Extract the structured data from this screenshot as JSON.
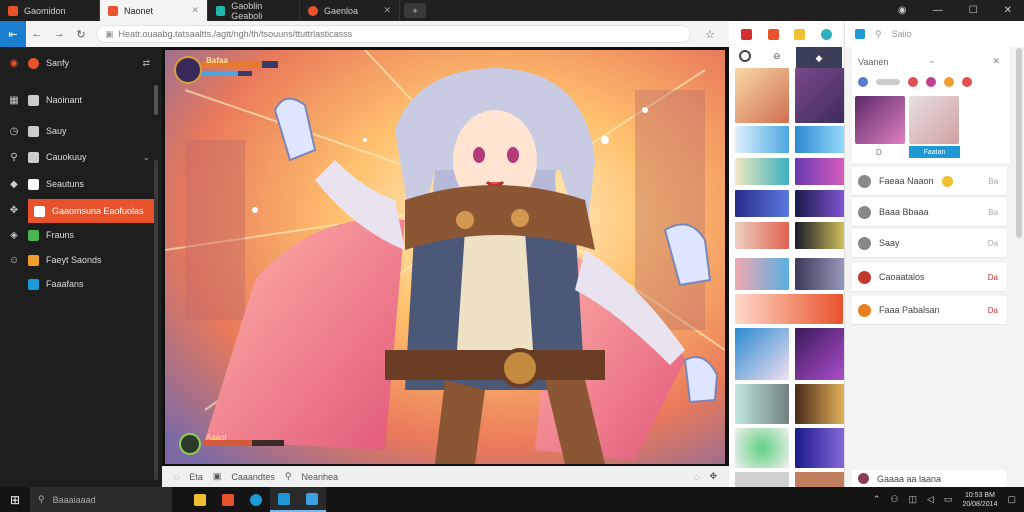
{
  "tabs": [
    {
      "label": "Gaomidon",
      "active": false,
      "color": "#e8532b"
    },
    {
      "label": "Naonet",
      "active": true,
      "color": "#e8532b"
    },
    {
      "label": "Gaoblin Geaboli",
      "active": false,
      "color": "#1fb6a9"
    },
    {
      "label": "Gaenloa",
      "active": false,
      "color": "#e8532b"
    }
  ],
  "address": {
    "url": "Heatr.ouaabg.tatsaaltts./agtt/ngh/th/tsouuns/ttuttrlasticasss"
  },
  "sidebar": {
    "header": "Sanfy",
    "items": [
      {
        "label": "Naoinant",
        "icon": "grid-icon",
        "color": "#cccccc"
      },
      {
        "label": "Sauy",
        "icon": "clock-icon",
        "color": "#cccccc"
      },
      {
        "label": "Cauokuuy",
        "icon": "pencil-icon",
        "color": "#cccccc"
      },
      {
        "label": "Seautuns",
        "icon": "image-icon",
        "color": "#ffffff"
      },
      {
        "label": "Gaaomsuna Eaofuolas",
        "icon": "gear-icon",
        "color": "#e8532b"
      },
      {
        "label": "Frauns",
        "icon": "photo-icon",
        "color": "#49b654"
      },
      {
        "label": "Faeyt Saonds",
        "icon": "folder-icon",
        "color": "#f0a030"
      },
      {
        "label": "Faaafans",
        "icon": "monitor-icon",
        "color": "#1d9ad6"
      }
    ]
  },
  "hud": {
    "top_label": "Bafaa",
    "bottom_label": "Aaaot"
  },
  "bottombar": {
    "left_a": "Eta",
    "left_b": "Caaandtes",
    "left_c": "Neanhea"
  },
  "panel": {
    "search_placeholder": "Saiio",
    "card_title": "Vaanen",
    "card_left_label": "D",
    "card_button": "Faatan",
    "items": [
      {
        "label": "Faeaa Naaon",
        "value": "Ba",
        "value_red": false,
        "color": "#888888"
      },
      {
        "label": "Baaa Bbaaa",
        "value": "Ba",
        "value_red": false,
        "color": "#888888"
      },
      {
        "label": "Saay",
        "value": "Da",
        "value_red": false,
        "color": "#888888"
      },
      {
        "label": "Caoaatalos",
        "value": "Da",
        "value_red": true,
        "color": "#c0392b"
      },
      {
        "label": "Faaa Pabalsan",
        "value": "Da",
        "value_red": true,
        "color": "#e67e22"
      }
    ],
    "bottom_label": "Gaaaa aa laana"
  },
  "taskbar": {
    "search_placeholder": "Baaaiaaad",
    "time": "10:53 BM",
    "date": "20/08/2014"
  }
}
